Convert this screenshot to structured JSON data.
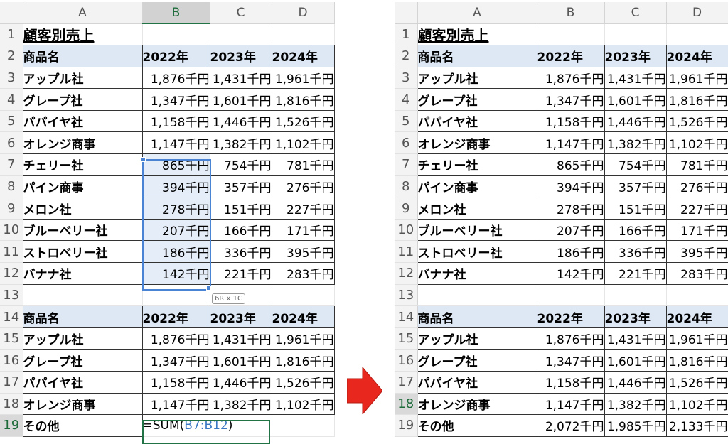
{
  "columns": [
    "A",
    "B",
    "C",
    "D"
  ],
  "title": "顧客別売上",
  "header_row": [
    "商品名",
    "2022年",
    "2023年",
    "2024年"
  ],
  "rows_top": [
    [
      "アップル社",
      "1,876千円",
      "1,431千円",
      "1,961千円"
    ],
    [
      "グレープ社",
      "1,347千円",
      "1,601千円",
      "1,816千円"
    ],
    [
      "パパイヤ社",
      "1,158千円",
      "1,446千円",
      "1,526千円"
    ],
    [
      "オレンジ商事",
      "1,147千円",
      "1,382千円",
      "1,102千円"
    ],
    [
      "チェリー社",
      "865千円",
      "754千円",
      "781千円"
    ],
    [
      "パイン商事",
      "394千円",
      "357千円",
      "276千円"
    ],
    [
      "メロン社",
      "278千円",
      "151千円",
      "227千円"
    ],
    [
      "ブルーベリー社",
      "207千円",
      "166千円",
      "171千円"
    ],
    [
      "ストロベリー社",
      "186千円",
      "336千円",
      "395千円"
    ],
    [
      "バナナ社",
      "142千円",
      "221千円",
      "283千円"
    ]
  ],
  "rows_bottom": [
    [
      "アップル社",
      "1,876千円",
      "1,431千円",
      "1,961千円"
    ],
    [
      "グレープ社",
      "1,347千円",
      "1,601千円",
      "1,816千円"
    ],
    [
      "パパイヤ社",
      "1,158千円",
      "1,446千円",
      "1,526千円"
    ],
    [
      "オレンジ商事",
      "1,147千円",
      "1,382千円",
      "1,102千円"
    ]
  ],
  "other_label": "その他",
  "left_formula": {
    "prefix": "=SUM(",
    "ref": "B7:B12",
    "suffix": ")"
  },
  "right_other_values": [
    "2,072千円",
    "1,985千円",
    "2,133千円"
  ],
  "selection_tip": "6R x 1C",
  "colors": {
    "header_fill": "#dde8f4",
    "selection": "#4a83d3",
    "arrow": "#e8281e"
  }
}
